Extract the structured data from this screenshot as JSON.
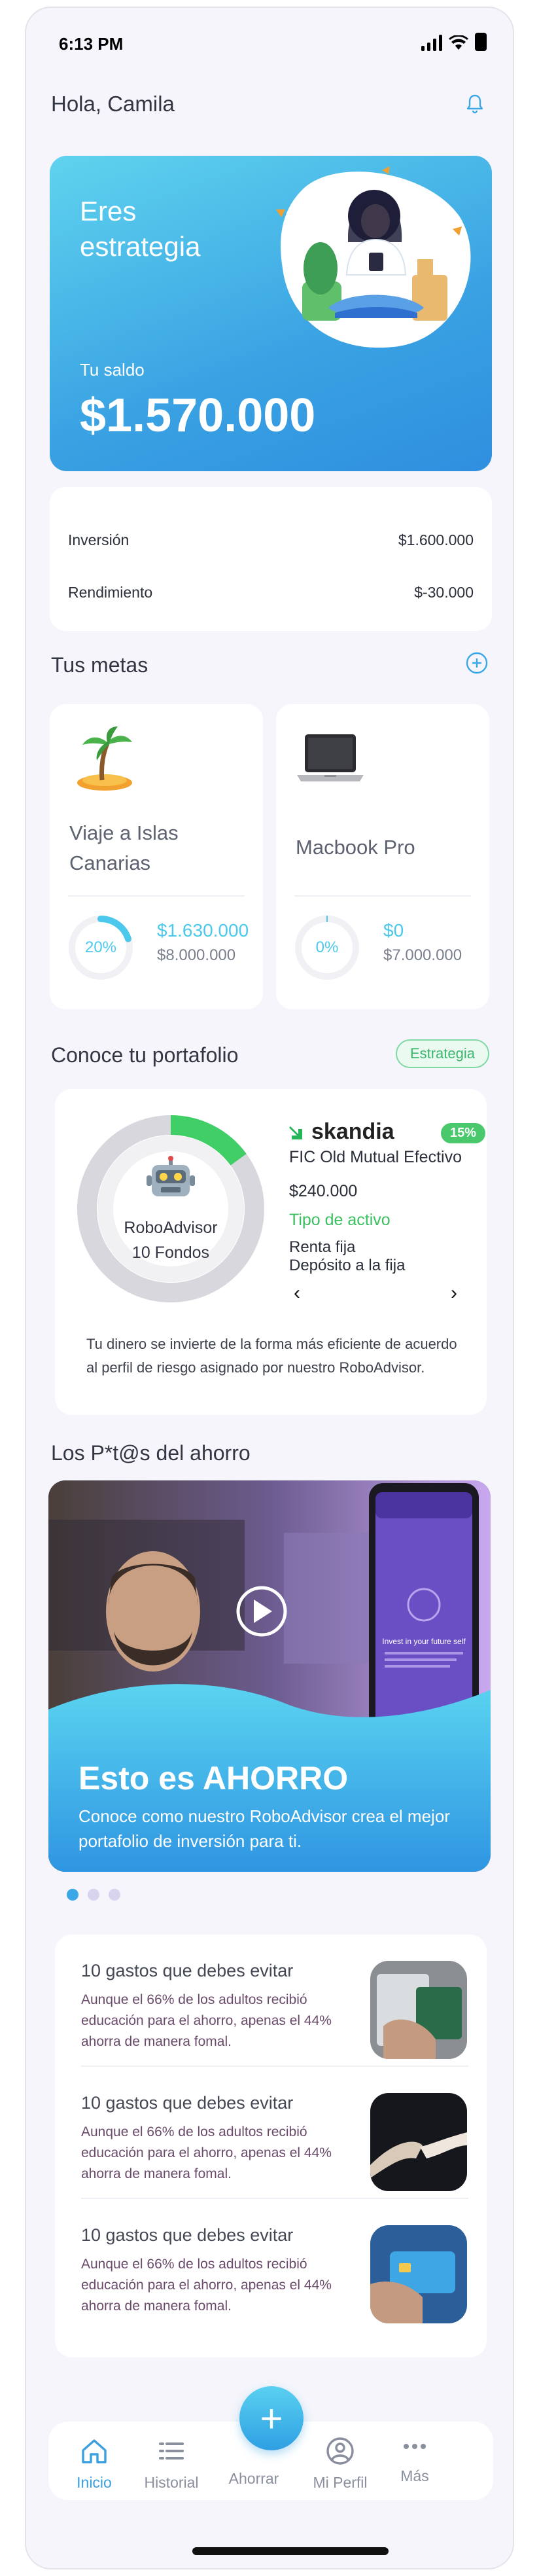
{
  "status_bar": {
    "time": "6:13 PM"
  },
  "header": {
    "greeting": "Hola, Camila"
  },
  "balance_card": {
    "profile": "Eres estrategia",
    "balance_label": "Tu saldo",
    "balance_value": "$1.570.000"
  },
  "summary": {
    "rows": [
      {
        "label": "Inversión",
        "value": "$1.600.000"
      },
      {
        "label": "Rendimiento",
        "value": "$-30.000"
      }
    ]
  },
  "goals": {
    "title": "Tus metas",
    "items": [
      {
        "name": "Viaje a Islas Canarias",
        "percent_label": "20%",
        "progress": 0.2,
        "saved": "$1.630.000",
        "target": "$8.000.000",
        "icon": "palm-island-icon"
      },
      {
        "name": "Macbook Pro",
        "percent_label": "0%",
        "progress": 0.0,
        "saved": "$0",
        "target": "$7.000.000",
        "icon": "laptop-icon"
      }
    ]
  },
  "portfolio": {
    "title": "Conoce tu portafolio",
    "badge": "Estrategia",
    "donut_title": "RoboAdvisor",
    "donut_sub": "10 Fondos",
    "donut_highlight_fraction": 0.15,
    "brand": "skandia",
    "percent": "15%",
    "fund_name": "FIC Old Mutual Efectivo",
    "fund_amount": "$240.000",
    "asset_type_label": "Tipo de activo",
    "asset_types": [
      "Renta fija",
      "Depósito a la fija"
    ],
    "description": "Tu dinero se invierte de la forma más eficiente de acuerdo al perfil de riesgo asignado por nuestro RoboAdvisor.",
    "colors": {
      "highlight": "#3fcf66",
      "track": "#d7d7dd"
    }
  },
  "savings": {
    "title": "Los P*t@s del ahorro",
    "video_title": "Esto es AHORRO",
    "video_desc": "Conoce como nuestro RoboAdvisor crea el mejor portafolio de inversión para ti.",
    "phone_screen_title": "Invest in your future self"
  },
  "articles": [
    {
      "title": "10 gastos que debes evitar",
      "body": "Aunque el 66% de los adultos recibió educación para el ahorro, apenas el 44% ahorra de manera fomal."
    },
    {
      "title": "10 gastos que debes evitar",
      "body": "Aunque el 66% de los adultos recibió educación para el ahorro, apenas el 44% ahorra de manera fomal."
    },
    {
      "title": "10 gastos que debes evitar",
      "body": "Aunque el 66% de los adultos recibió educación para el ahorro, apenas el 44% ahorra de manera fomal."
    }
  ],
  "nav": {
    "items": [
      {
        "label": "Inicio",
        "icon": "home-icon"
      },
      {
        "label": "Historial",
        "icon": "list-icon"
      },
      {
        "label": "Ahorrar",
        "icon": "plus-icon"
      },
      {
        "label": "Mi Perfil",
        "icon": "profile-icon"
      },
      {
        "label": "Más",
        "icon": "more-icon"
      }
    ],
    "fab_symbol": "+"
  }
}
